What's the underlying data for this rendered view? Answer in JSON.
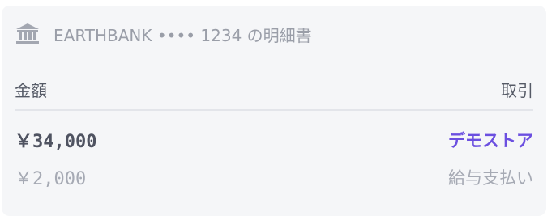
{
  "statement": {
    "header_text": "EARTHBANK •••• 1234 の明細書",
    "icon": "bank-icon"
  },
  "columns": {
    "amount_label": "金額",
    "transaction_label": "取引"
  },
  "transaction": {
    "amount": "￥34,000",
    "merchant": "デモストア",
    "sub_amount": "￥2,000",
    "sub_description": "給与支払い"
  },
  "colors": {
    "card_background": "#f5f6f8",
    "accent": "#6b4fe0",
    "muted_text": "#a6aab4",
    "strong_text": "#4f5361"
  }
}
